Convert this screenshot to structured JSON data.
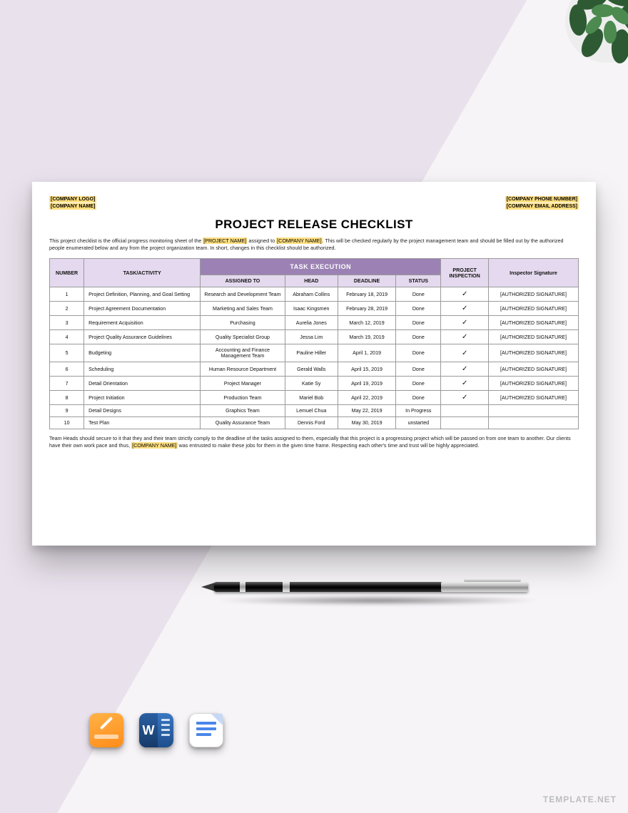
{
  "watermark": "TEMPLATE.NET",
  "header": {
    "left": {
      "logo": "[COMPANY LOGO]",
      "name": "[COMPANY NAME]"
    },
    "right": {
      "phone": "[COMPANY PHONE NUMBER]",
      "email": "[COMPANY EMAIL ADDRESS]"
    }
  },
  "title": "PROJECT RELEASE CHECKLIST",
  "intro": {
    "p1": "This project checklist is the official progress monitoring sheet of the ",
    "m1": "[PROJECT NAME]",
    "p2": " assigned to ",
    "m2": "[COMPANY NAME]",
    "p3": ". This will be checked regularly by the project management team and should be filled out by the authorized people enumerated below and any from the project organization team. In short, changes in this checklist should be authorized."
  },
  "columns": {
    "number": "NUMBER",
    "task": "TASK/ACTIVITY",
    "execution": "TASK EXECUTION",
    "assigned": "ASSIGNED TO",
    "head": "HEAD",
    "deadline": "DEADLINE",
    "status": "STATUS",
    "inspection": "PROJECT INSPECTION",
    "signature": "Inspector Signature"
  },
  "rows": [
    {
      "n": "1",
      "task": "Project Definition, Planning, and Goal Setting",
      "assigned": "Research and Development Team",
      "head": "Abraham Collins",
      "deadline": "February 18, 2019",
      "status": "Done",
      "chk": "✓",
      "sig": "[AUTHORIZED SIGNATURE]"
    },
    {
      "n": "2",
      "task": "Project Agreement Documentation",
      "assigned": "Marketing and Sales Team",
      "head": "Isaac Kingsmen",
      "deadline": "February 28, 2019",
      "status": "Done",
      "chk": "✓",
      "sig": "[AUTHORIZED SIGNATURE]"
    },
    {
      "n": "3",
      "task": "Requirement Acquisition",
      "assigned": "Purchasing",
      "head": "Aurelia Jones",
      "deadline": "March 12, 2019",
      "status": "Done",
      "chk": "✓",
      "sig": "[AUTHORIZED SIGNATURE]"
    },
    {
      "n": "4",
      "task": "Project Quality Assurance Guidelines",
      "assigned": "Quality Specialist Group",
      "head": "Jessa Lim",
      "deadline": "March 19, 2019",
      "status": "Done",
      "chk": "✓",
      "sig": "[AUTHORIZED SIGNATURE]"
    },
    {
      "n": "5",
      "task": "Budgeting",
      "assigned": "Accounting and Finance Management Team",
      "head": "Pauline Hiller",
      "deadline": "April 1, 2019",
      "status": "Done",
      "chk": "✓",
      "sig": "[AUTHORIZED SIGNATURE]"
    },
    {
      "n": "6",
      "task": "Scheduling",
      "assigned": "Human Resource Department",
      "head": "Gerald Walls",
      "deadline": "April 15, 2019",
      "status": "Done",
      "chk": "✓",
      "sig": "[AUTHORIZED SIGNATURE]"
    },
    {
      "n": "7",
      "task": "Detail Orientation",
      "assigned": "Project Manager",
      "head": "Katie Sy",
      "deadline": "April 19, 2019",
      "status": "Done",
      "chk": "✓",
      "sig": "[AUTHORIZED SIGNATURE]"
    },
    {
      "n": "8",
      "task": "Project Initiation",
      "assigned": "Production Team",
      "head": "Mariel Bob",
      "deadline": "April 22, 2019",
      "status": "Done",
      "chk": "✓",
      "sig": "[AUTHORIZED SIGNATURE]"
    },
    {
      "n": "9",
      "task": "Detail Designs",
      "assigned": "Graphics Team",
      "head": "Lemuel Chua",
      "deadline": "May 22, 2019",
      "status": "In Progress",
      "chk": "",
      "sig": ""
    },
    {
      "n": "10",
      "task": "Test Plan",
      "assigned": "Quality Assurance Team",
      "head": "Dennis Ford",
      "deadline": "May 30, 2019",
      "status": "unstarted",
      "chk": "",
      "sig": ""
    }
  ],
  "outro": {
    "p1": "Team Heads should secure to it that they and their team strictly comply to the deadline of the tasks assigned to them, especially that this project is a progressing project which will be passed on from one team to another. Our clients have their own work pace and thus, ",
    "m1": "[COMPANY NAME]",
    "p2": " was entrusted to make these jobs for them in the given time frame. Respecting each other's time and trust will be highly appreciated."
  },
  "apps": {
    "word_letter": "W"
  }
}
